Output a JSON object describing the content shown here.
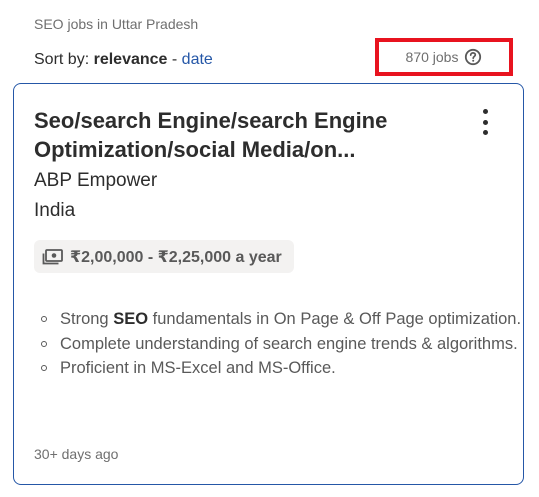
{
  "breadcrumb": "SEO jobs in Uttar Pradesh",
  "sort": {
    "prefix": "Sort by:",
    "active": "relevance",
    "separator": "-",
    "alternate": "date"
  },
  "job_count": "870 jobs",
  "highlight_color": "#e8131f",
  "card": {
    "title_line1": "Seo/search Engine/search Engine",
    "title_line2": "Optimization/social Media/on...",
    "company": "ABP Empower",
    "location": "India",
    "salary": "₹2,00,000 - ₹2,25,000 a year",
    "salary_icon": "money-icon",
    "menu_icon": "more-vertical-icon",
    "snippet": {
      "item1_before": "Strong ",
      "item1_bold": "SEO",
      "item1_after": " fundamentals in On Page & Off Page optimization.",
      "item2": "Complete understanding of search engine trends & algorithms.",
      "item3": "Proficient in MS-Excel and MS-Office."
    },
    "posted": "30+ days ago"
  }
}
